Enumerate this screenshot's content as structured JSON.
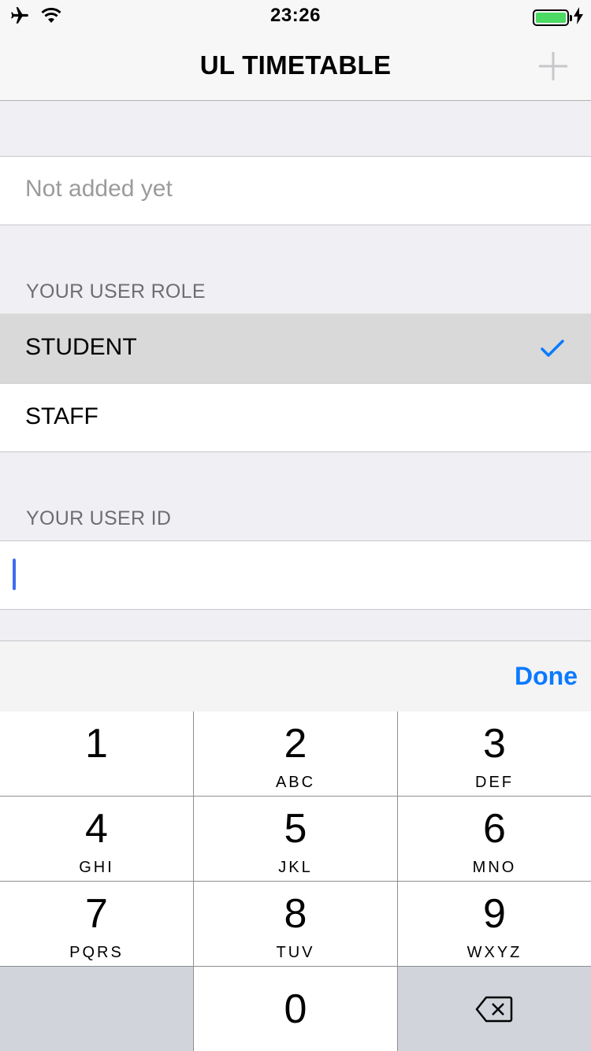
{
  "status_bar": {
    "time": "23:26",
    "icons": [
      "airplane-icon",
      "wifi-icon",
      "battery-icon",
      "charging-bolt-icon"
    ],
    "battery_color": "#4cd964"
  },
  "nav": {
    "title": "UL TIMETABLE",
    "add_icon": "plus-icon"
  },
  "table": {
    "first_cell": "Not added yet",
    "role_section": {
      "header": "YOUR USER ROLE",
      "options": [
        {
          "label": "STUDENT",
          "selected": true
        },
        {
          "label": "STAFF",
          "selected": false
        }
      ]
    },
    "id_section": {
      "header": "YOUR USER ID",
      "value": ""
    }
  },
  "keyboard": {
    "done_label": "Done",
    "accent_color": "#0a7aff",
    "keys": [
      {
        "digit": "1",
        "letters": ""
      },
      {
        "digit": "2",
        "letters": "ABC"
      },
      {
        "digit": "3",
        "letters": "DEF"
      },
      {
        "digit": "4",
        "letters": "GHI"
      },
      {
        "digit": "5",
        "letters": "JKL"
      },
      {
        "digit": "6",
        "letters": "MNO"
      },
      {
        "digit": "7",
        "letters": "PQRS"
      },
      {
        "digit": "8",
        "letters": "TUV"
      },
      {
        "digit": "9",
        "letters": "WXYZ"
      },
      {
        "digit": "0",
        "letters": ""
      }
    ],
    "delete_icon": "backspace-icon"
  }
}
